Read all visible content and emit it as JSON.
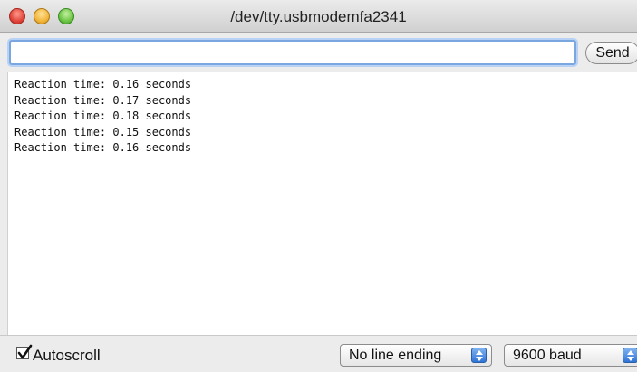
{
  "window": {
    "title": "/dev/tty.usbmodemfa2341"
  },
  "send_row": {
    "input_value": "",
    "send_label": "Send"
  },
  "log": {
    "lines": [
      "Reaction time: 0.16 seconds",
      "Reaction time: 0.17 seconds",
      "Reaction time: 0.18 seconds",
      "Reaction time: 0.15 seconds",
      "Reaction time: 0.16 seconds"
    ]
  },
  "bottom_bar": {
    "autoscroll_label": "Autoscroll",
    "autoscroll_checked": true,
    "line_ending_selected": "No line ending",
    "baud_selected": "9600 baud"
  },
  "icons": {
    "close": "close-button-red",
    "minimize": "minimize-button-yellow",
    "maximize": "zoom-button-green",
    "select_arrows": "updown-stepper-icon",
    "checkmark": "checkmark-icon"
  },
  "colors": {
    "close": "#e0443a",
    "minimize": "#f2b53a",
    "maximize": "#6cc545",
    "focus_ring": "#7aa7e0",
    "stepper": "#2f74d6"
  }
}
